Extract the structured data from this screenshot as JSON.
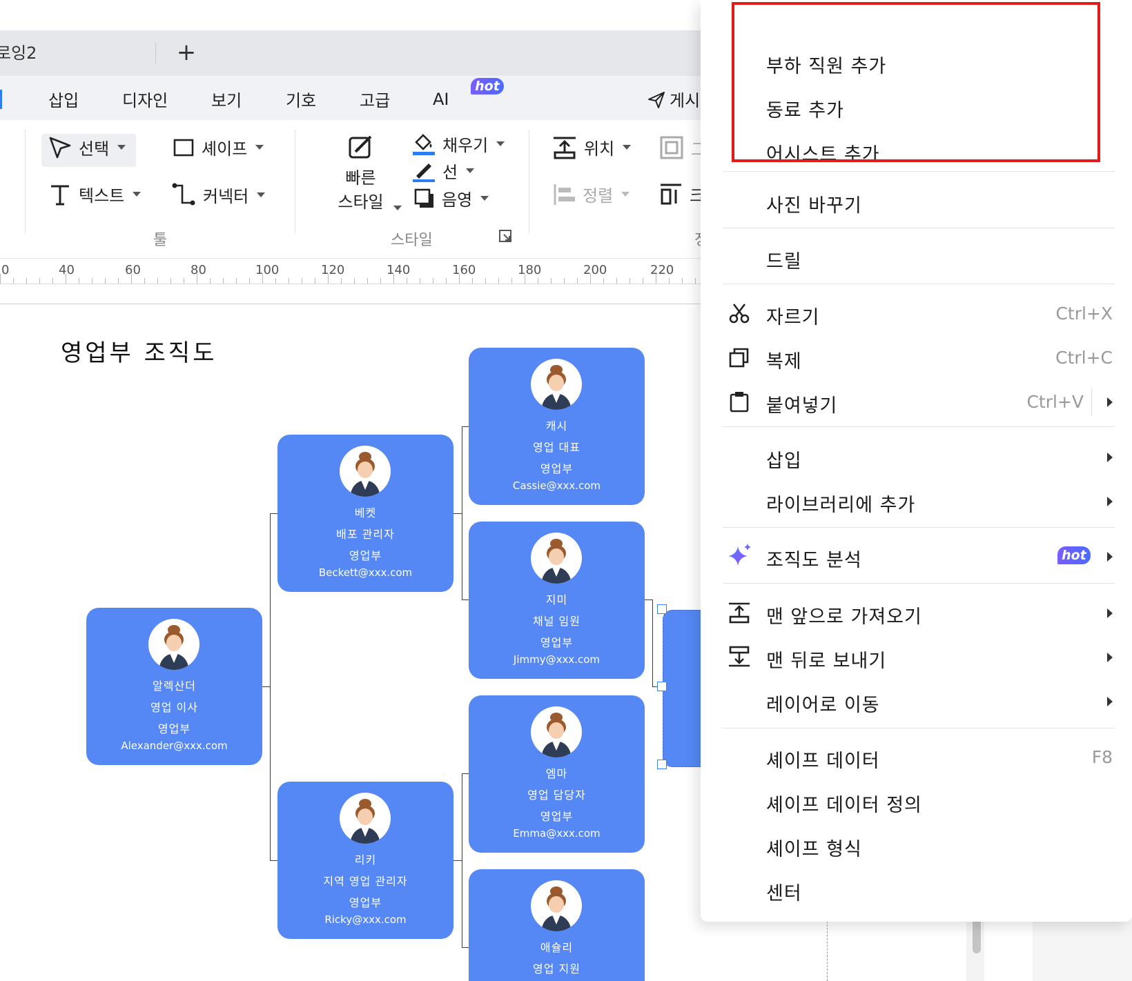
{
  "tabs": {
    "doc_label": "로잉2",
    "new_tab": "+"
  },
  "menu": {
    "items": [
      "삽입",
      "디자인",
      "보기",
      "기호",
      "고급",
      "AI"
    ],
    "ai_badge": "hot",
    "share": "게시"
  },
  "ribbon": {
    "select": "선택",
    "shape": "셰이프",
    "text": "텍스트",
    "connector": "커넥터",
    "tools_label": "툴",
    "quick_style_1": "빠른",
    "quick_style_2": "스타일",
    "fill": "채우기",
    "line": "선",
    "shadow": "음영",
    "style_label": "스타일",
    "position": "위치",
    "align": "정렬",
    "partial_1": "그",
    "partial_2": "크",
    "partial_3": "정"
  },
  "ruler": [
    "0",
    "40",
    "60",
    "80",
    "100",
    "120",
    "140",
    "160",
    "180",
    "200",
    "220"
  ],
  "chart": {
    "title": "영업부 조직도",
    "cards": {
      "alexander": {
        "name": "알렉산더",
        "role": "영업 이사",
        "dept": "영업부",
        "email": "Alexander@xxx.com"
      },
      "beckett": {
        "name": "베켓",
        "role": "배포 관리자",
        "dept": "영업부",
        "email": "Beckett@xxx.com"
      },
      "ricky": {
        "name": "리키",
        "role": "지역 영업 관리자",
        "dept": "영업부",
        "email": "Ricky@xxx.com"
      },
      "cassie": {
        "name": "캐시",
        "role": "영업 대표",
        "dept": "영업부",
        "email": "Cassie@xxx.com"
      },
      "jimmy": {
        "name": "지미",
        "role": "채널 임원",
        "dept": "영업부",
        "email": "Jimmy@xxx.com"
      },
      "emma": {
        "name": "엠마",
        "role": "영업 담당자",
        "dept": "영업부",
        "email": "Emma@xxx.com"
      },
      "ashley": {
        "name": "애슐리",
        "role": "영업 지원"
      }
    }
  },
  "context_menu": {
    "add_subordinate": "부하 직원 추가",
    "add_colleague": "동료 추가",
    "add_assistant": "어시스트 추가",
    "change_photo": "사진 바꾸기",
    "drill": "드릴",
    "cut": "자르기",
    "cut_shortcut": "Ctrl+X",
    "copy": "복제",
    "copy_shortcut": "Ctrl+C",
    "paste": "붙여넣기",
    "paste_shortcut": "Ctrl+V",
    "insert": "삽입",
    "add_to_library": "라이브러리에 추가",
    "org_analysis": "조직도 분석",
    "org_badge": "hot",
    "bring_front": "맨 앞으로 가져오기",
    "send_back": "맨 뒤로 보내기",
    "move_layer": "레이어로 이동",
    "shape_data": "셰이프 데이터",
    "shape_data_shortcut": "F8",
    "shape_data_def": "셰이프 데이터 정의",
    "shape_format": "셰이프 형식",
    "center": "센터"
  },
  "colors": {
    "card": "#5588f4",
    "accent": "#2e7bf6",
    "highlight": "#e31a1a",
    "hot": "#6b5cff"
  }
}
